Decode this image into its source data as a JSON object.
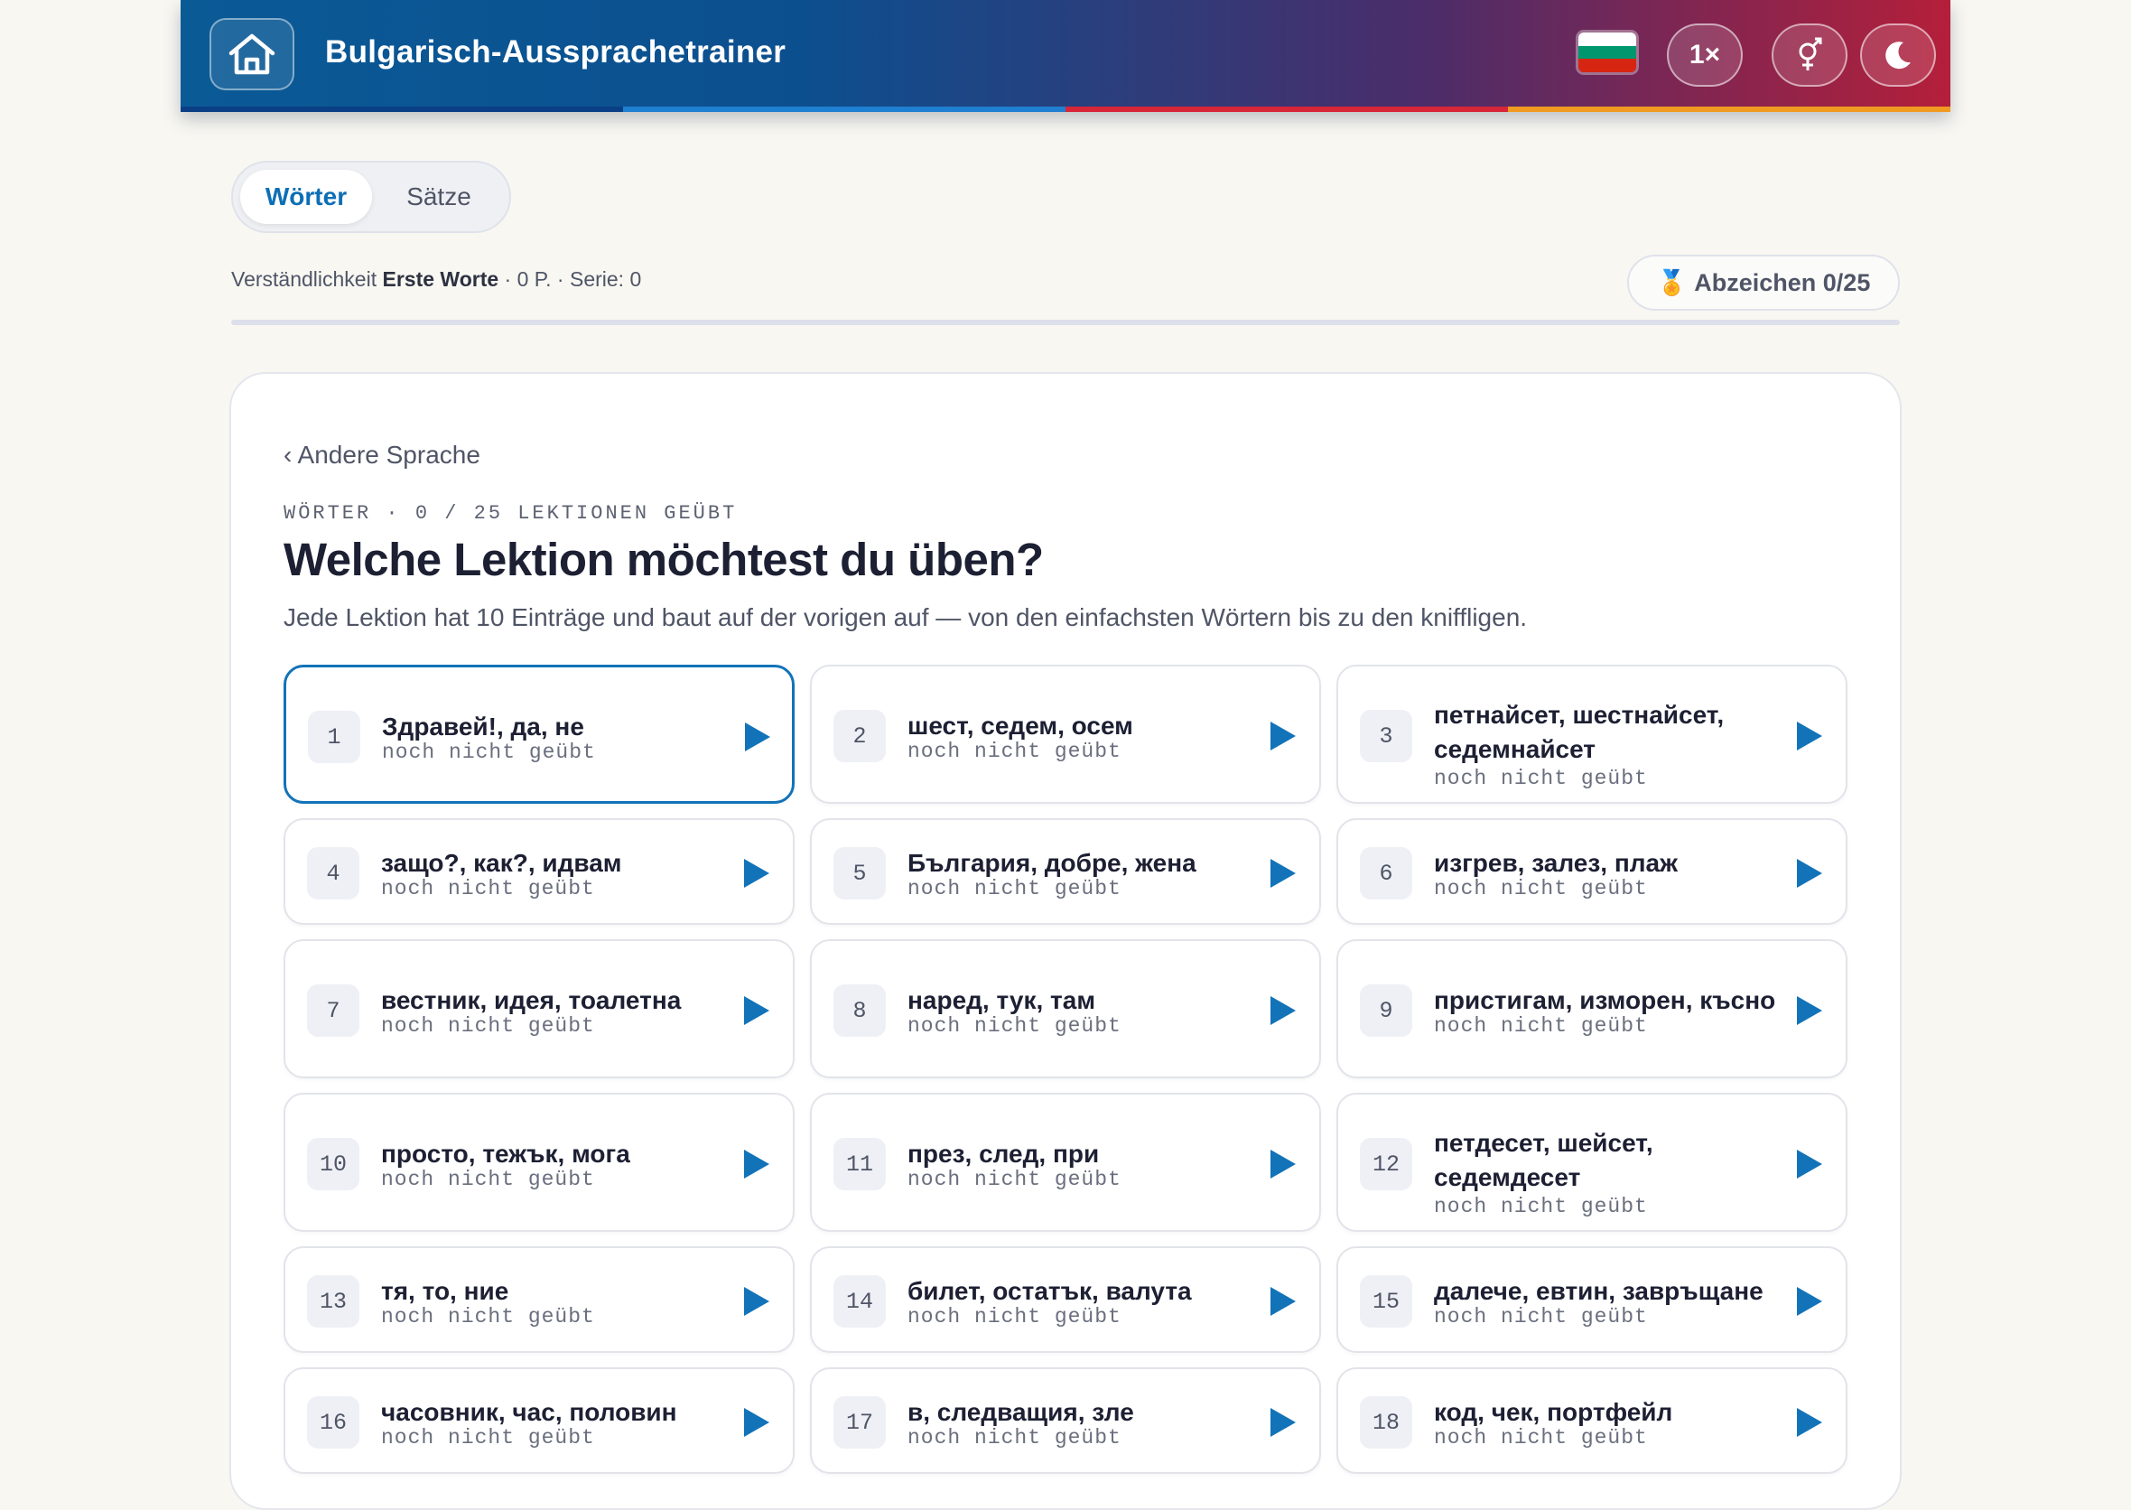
{
  "header": {
    "title": "Bulgarisch-Aussprachetrainer",
    "speed_label": "1×",
    "icons": {
      "home": "home-icon",
      "gender": "gender-icon",
      "theme": "moon-icon",
      "flag": "bulgaria-flag-icon"
    },
    "colors": {
      "stripe": [
        "#0a3f86",
        "#1f7fd0",
        "#d6283e",
        "#f09a22"
      ],
      "flag": [
        "#ffffff",
        "#00966e",
        "#d62612"
      ]
    }
  },
  "tabs": [
    {
      "label": "Wörter",
      "active": true
    },
    {
      "label": "Sätze",
      "active": false
    }
  ],
  "stats": {
    "prefix": "Verständlichkeit ",
    "level": "Erste Worte",
    "suffix": " · 0 P. · Serie: 0",
    "badge_icon": "🏅",
    "badge_label": "Abzeichen 0/25",
    "progress": 0
  },
  "main": {
    "back_link": "‹ Andere Sprache",
    "eyebrow": "WÖRTER · 0 / 25 LEKTIONEN GEÜBT",
    "heading": "Welche Lektion möchtest du üben?",
    "subtext": "Jede Lektion hat 10 Einträge und baut auf der vorigen auf — von den einfachsten Wörtern bis zu den kniffligen."
  },
  "lessons": [
    {
      "num": "1",
      "words": "Здравей!, да, не",
      "status": "noch nicht geübt",
      "selected": true
    },
    {
      "num": "2",
      "words": "шест, седем, осем",
      "status": "noch nicht geübt"
    },
    {
      "num": "3",
      "words": "петнайсет, шестнайсет, седемнайсет",
      "status": "noch nicht geübt"
    },
    {
      "num": "4",
      "words": "защо?, как?, идвам",
      "status": "noch nicht geübt"
    },
    {
      "num": "5",
      "words": "България, добре, жена",
      "status": "noch nicht geübt"
    },
    {
      "num": "6",
      "words": "изгрев, залез, плаж",
      "status": "noch nicht geübt"
    },
    {
      "num": "7",
      "words": "вестник, идея, тоалетна",
      "status": "noch nicht geübt"
    },
    {
      "num": "8",
      "words": "наред, тук, там",
      "status": "noch nicht geübt"
    },
    {
      "num": "9",
      "words": "пристигам, изморен, късно",
      "status": "noch nicht geübt"
    },
    {
      "num": "10",
      "words": "просто, тежък, мога",
      "status": "noch nicht geübt"
    },
    {
      "num": "11",
      "words": "през, след, при",
      "status": "noch nicht geübt"
    },
    {
      "num": "12",
      "words": "петдесет, шейсет, седемдесет",
      "status": "noch nicht geübt"
    },
    {
      "num": "13",
      "words": "тя, то, ние",
      "status": "noch nicht geübt"
    },
    {
      "num": "14",
      "words": "билет, остатък, валута",
      "status": "noch nicht geübt"
    },
    {
      "num": "15",
      "words": "далече, евтин, завръщане",
      "status": "noch nicht geübt"
    },
    {
      "num": "16",
      "words": "часовник, час, половин",
      "status": "noch nicht geübt"
    },
    {
      "num": "17",
      "words": "в, следващия, зле",
      "status": "noch nicht geübt"
    },
    {
      "num": "18",
      "words": "код, чек, портфейл",
      "status": "noch nicht geübt"
    }
  ]
}
